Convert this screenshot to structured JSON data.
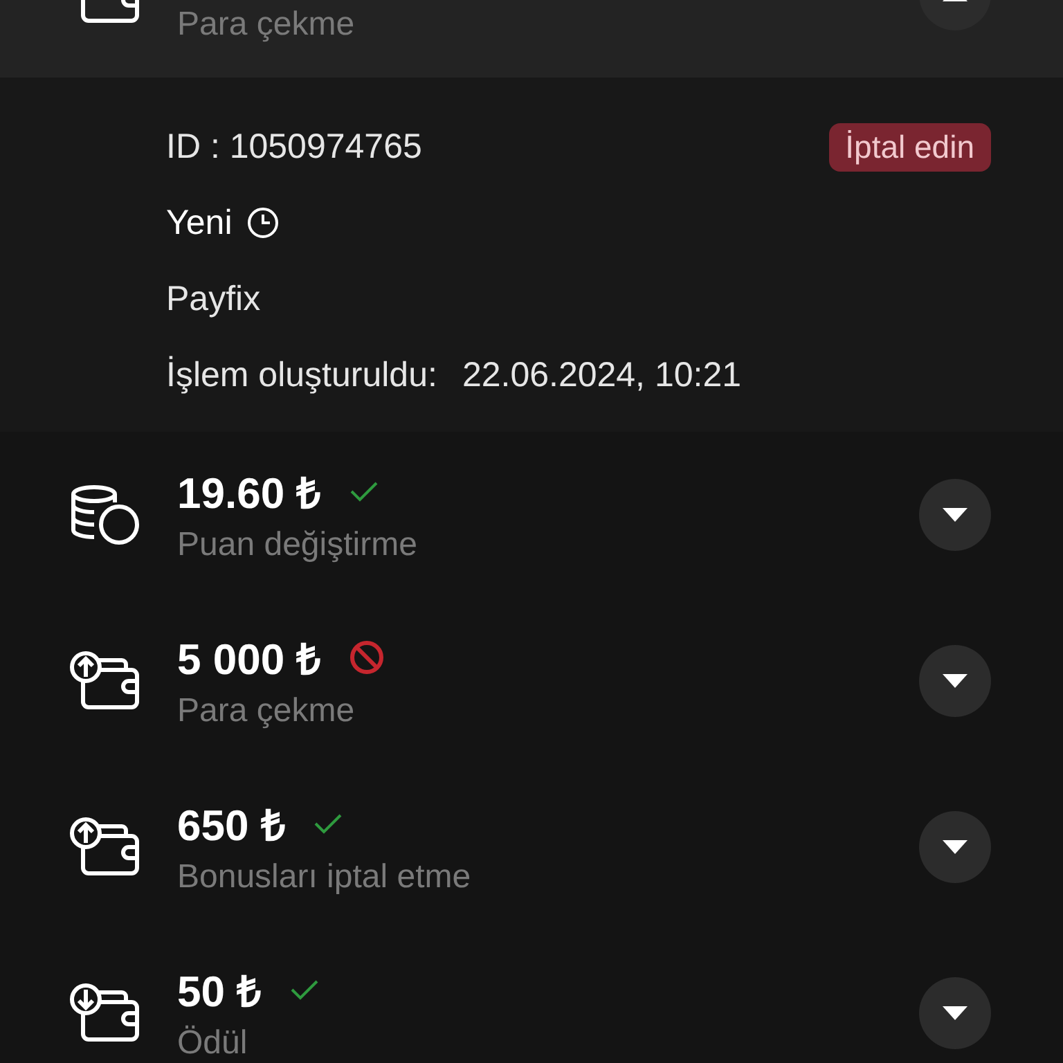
{
  "transactions": [
    {
      "kind": "withdraw",
      "subtitle": "Para çekme",
      "expanded": true,
      "details": {
        "id": "ID : 1050974765",
        "cancel_button": "İptal edin",
        "status": "Yeni",
        "method": "Payfix",
        "created_label": "İşlem oluşturuldu:",
        "created_value": "22.06.2024, 10:21"
      }
    },
    {
      "kind": "coins",
      "amount": "19.60 ₺",
      "status": {
        "kind": "success"
      },
      "subtitle": "Puan değiştirme",
      "expanded": false
    },
    {
      "kind": "withdraw",
      "amount": "5 000 ₺",
      "status": {
        "kind": "rejected"
      },
      "subtitle": "Para çekme",
      "expanded": false
    },
    {
      "kind": "withdraw",
      "amount": "650 ₺",
      "status": {
        "kind": "success"
      },
      "subtitle": "Bonusları iptal etme",
      "expanded": false
    },
    {
      "kind": "deposit",
      "amount": "50 ₺",
      "status": {
        "kind": "success"
      },
      "subtitle": "Ödül",
      "expanded": false
    }
  ]
}
